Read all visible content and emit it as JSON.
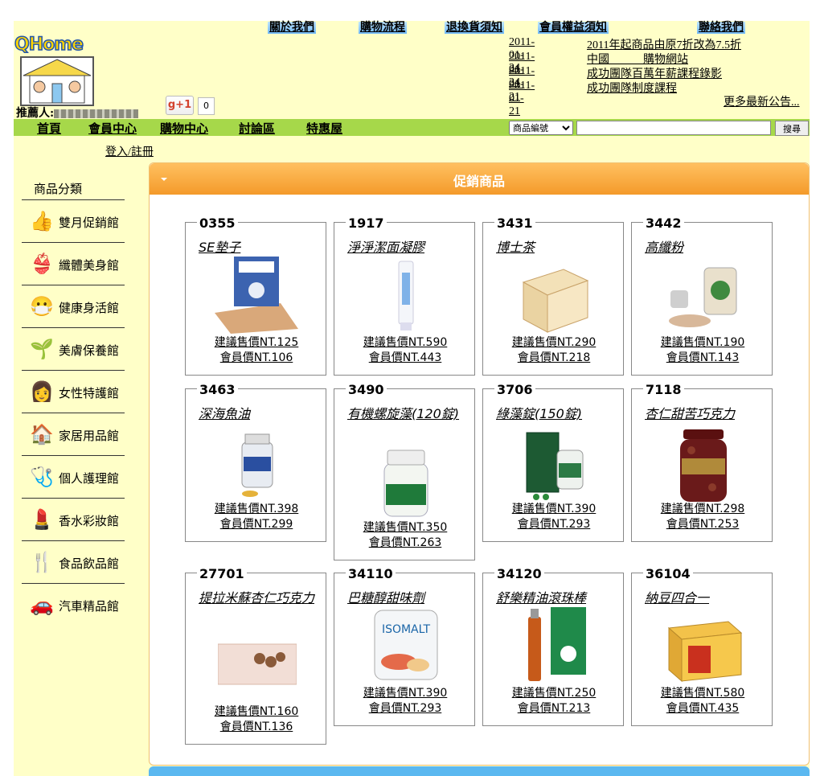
{
  "logo": {
    "text": "QHome"
  },
  "header": {
    "recommender_label": "推薦人:",
    "gplus_label": "g+1",
    "gplus_count": "0",
    "top_links": [
      "關於我們",
      "購物流程",
      "退換貨須知",
      "會員權益須知",
      "聯絡我們"
    ],
    "news": [
      {
        "date": "2011-01-24",
        "title": "2011年起商品由原7折改為7.5折"
      },
      {
        "date": "2011-01-24",
        "title": "中國　　　購物網站"
      },
      {
        "date": "2011-01-21",
        "title": "成功團隊百萬年薪課程錄影"
      },
      {
        "date": "2011-01-21",
        "title": "成功團隊制度課程"
      }
    ],
    "more_news": "更多最新公告..."
  },
  "nav": {
    "items": [
      "首頁",
      "會員中心",
      "購物中心",
      "討論區",
      "特惠屋"
    ],
    "search_select": "商品編號",
    "search_value": "",
    "search_button": "搜尋"
  },
  "login_link": "登入/註冊",
  "sidebar": {
    "title": "商品分類",
    "items": [
      {
        "label": "雙月促銷館",
        "icon": "thumbs-up-icon"
      },
      {
        "label": "纖體美身館",
        "icon": "bikini-icon"
      },
      {
        "label": "健康身活館",
        "icon": "health-icon"
      },
      {
        "label": "美膚保養館",
        "icon": "sprout-icon"
      },
      {
        "label": "女性特護館",
        "icon": "woman-icon"
      },
      {
        "label": "家居用品館",
        "icon": "house-icon"
      },
      {
        "label": "個人護理館",
        "icon": "nurse-icon"
      },
      {
        "label": "香水彩妝館",
        "icon": "makeup-icon"
      },
      {
        "label": "食品飲品館",
        "icon": "cutlery-icon"
      },
      {
        "label": "汽車精品館",
        "icon": "car-icon"
      }
    ]
  },
  "panel": {
    "title": "促銷商品"
  },
  "products": [
    {
      "code": "0355",
      "name": "SE墊子",
      "retail": "建議售價NT.125",
      "member": "會員價NT.106"
    },
    {
      "code": "1917",
      "name": "淨淨潔面凝膠",
      "retail": "建議售價NT.590",
      "member": "會員價NT.443"
    },
    {
      "code": "3431",
      "name": "博士茶",
      "retail": "建議售價NT.290",
      "member": "會員價NT.218"
    },
    {
      "code": "3442",
      "name": "高纖粉",
      "retail": "建議售價NT.190",
      "member": "會員價NT.143"
    },
    {
      "code": "3463",
      "name": "深海魚油",
      "retail": "建議售價NT.398",
      "member": "會員價NT.299"
    },
    {
      "code": "3490",
      "name": "有機螺旋藻(120錠)",
      "retail": "建議售價NT.350",
      "member": "會員價NT.263"
    },
    {
      "code": "3706",
      "name": "綠藻錠(150錠)",
      "retail": "建議售價NT.390",
      "member": "會員價NT.293"
    },
    {
      "code": "7118",
      "name": "杏仁甜苦巧克力",
      "retail": "建議售價NT.298",
      "member": "會員價NT.253"
    },
    {
      "code": "27701",
      "name": "提拉米蘇杏仁巧克力",
      "retail": "建議售價NT.160",
      "member": "會員價NT.136"
    },
    {
      "code": "34110",
      "name": "巴糖醇甜味劑",
      "retail": "建議售價NT.390",
      "member": "會員價NT.293"
    },
    {
      "code": "34120",
      "name": "舒樂精油滾珠棒",
      "retail": "建議售價NT.250",
      "member": "會員價NT.213"
    },
    {
      "code": "36104",
      "name": "納豆四合一",
      "retail": "建議售價NT.580",
      "member": "會員價NT.435"
    }
  ],
  "colors": {
    "nav": "#a6d84a",
    "background": "#ffffc8",
    "panel_header": "#f49a2a"
  }
}
